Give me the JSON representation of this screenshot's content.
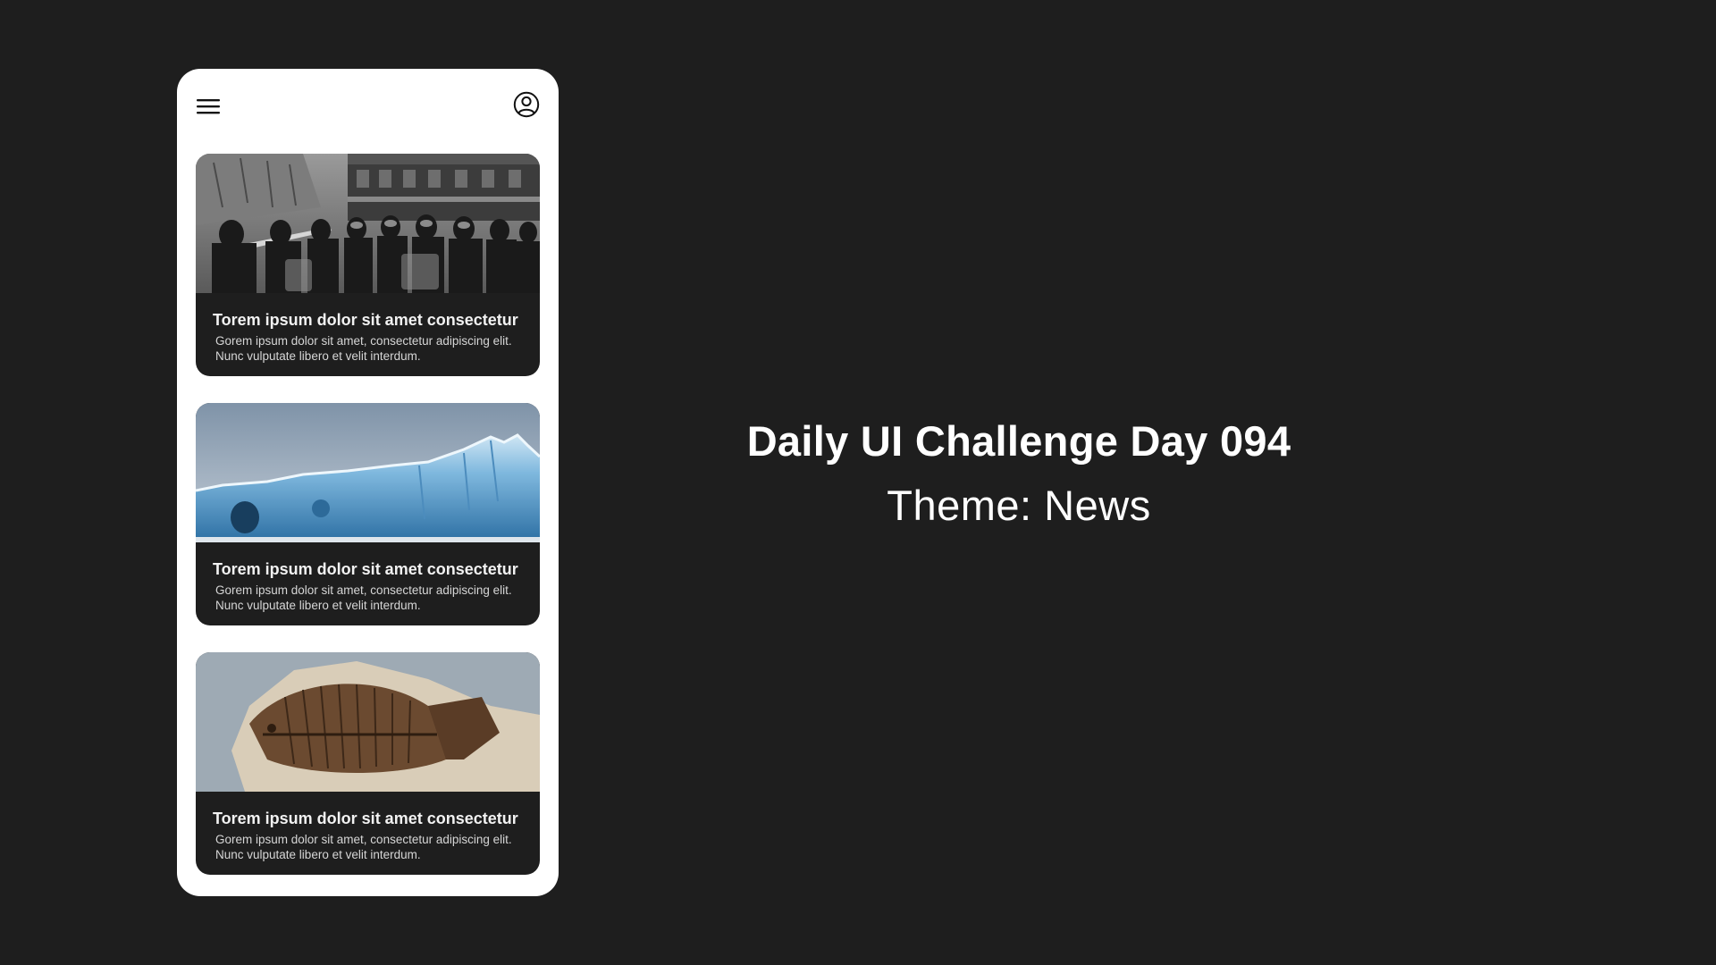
{
  "app": {
    "header": {
      "menu_icon": "hamburger-menu-icon",
      "profile_icon": "user-circle-icon"
    },
    "articles": [
      {
        "image": "protest-police-photo",
        "title": "Torem ipsum dolor sit amet consectetur",
        "description": "Gorem ipsum dolor sit amet, consectetur adipiscing elit. Nunc vulputate libero et velit interdum."
      },
      {
        "image": "iceberg-photo",
        "title": "Torem ipsum dolor sit amet consectetur",
        "description": "Gorem ipsum dolor sit amet, consectetur adipiscing elit. Nunc vulputate libero et velit interdum."
      },
      {
        "image": "fish-fossil-photo",
        "title": "Torem ipsum dolor sit amet consectetur",
        "description": "Gorem ipsum dolor sit amet, consectetur adipiscing elit. Nunc vulputate libero et velit interdum."
      }
    ]
  },
  "showcase": {
    "title": "Daily UI Challenge Day 094",
    "subtitle": "Theme: News"
  },
  "colors": {
    "background": "#1e1e1e",
    "phone": "#ffffff",
    "card": "#1e1e1e",
    "text": "#ffffff"
  }
}
